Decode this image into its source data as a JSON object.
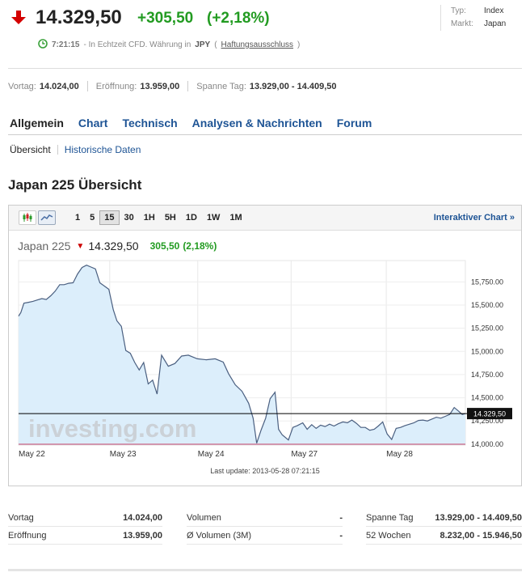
{
  "quote": {
    "price": "14.329,50",
    "change": "+305,50",
    "change_pct": "(+2,18%)",
    "direction_color": "#d40000",
    "positive_color": "#229b21",
    "time": "7:21:15",
    "realtime_text": "- In Echtzeit CFD. Währung in",
    "currency": "JPY",
    "disclaimer_open": "(",
    "disclaimer_link": "Haftungsausschluss",
    "disclaimer_close": ")"
  },
  "meta": [
    {
      "key": "Typ:",
      "value": "Index"
    },
    {
      "key": "Markt:",
      "value": "Japan"
    }
  ],
  "summary": [
    {
      "label": "Vortag:",
      "value": "14.024,00"
    },
    {
      "label": "Eröffnung:",
      "value": "13.959,00"
    },
    {
      "label": "Spanne Tag:",
      "value": "13.929,00 - 14.409,50"
    }
  ],
  "tabs": [
    {
      "label": "Allgemein",
      "active": true
    },
    {
      "label": "Chart",
      "active": false
    },
    {
      "label": "Technisch",
      "active": false
    },
    {
      "label": "Analysen & Nachrichten",
      "active": false
    },
    {
      "label": "Forum",
      "active": false
    }
  ],
  "subtabs": [
    {
      "label": "Übersicht",
      "active": true
    },
    {
      "label": "Historische Daten",
      "active": false
    }
  ],
  "page_title": "Japan 225 Übersicht",
  "chart_widget": {
    "ranges": [
      "1",
      "5",
      "15",
      "30",
      "1H",
      "5H",
      "1D",
      "1W",
      "1M"
    ],
    "selected_range": "15",
    "interactive_label": "Interaktiver Chart »",
    "name": "Japan 225",
    "price": "14.329,50",
    "change": "305,50",
    "change_pct": "(2,18%)",
    "last_update": "Last update: 2013-05-28 07:21:15",
    "watermark": "investing.com",
    "price_badge": "14.329,50"
  },
  "chart_data": {
    "type": "area",
    "title": "",
    "xlabel": "",
    "ylabel": "",
    "ylim": [
      13990,
      15980
    ],
    "x_ticks": [
      "May 22",
      "May 23",
      "May 24",
      "May 27",
      "May 28"
    ],
    "y_ticks": [
      14000,
      14250,
      14500,
      14750,
      15000,
      15250,
      15500,
      15750
    ],
    "y_tick_labels": [
      "14,000.00",
      "14,250.00",
      "14,500.00",
      "14,750.00",
      "15,000.00",
      "15,250.00",
      "15,500.00",
      "15,750.00"
    ],
    "reference_line": 14329.5,
    "line_color": "#4a5f80",
    "fill_color": "#dceefb",
    "series": [
      {
        "points": [
          [
            0,
            15380
          ],
          [
            0.5,
            15420
          ],
          [
            1.2,
            15520
          ],
          [
            2.2,
            15530
          ],
          [
            3.2,
            15540
          ],
          [
            4.2,
            15555
          ],
          [
            5.2,
            15570
          ],
          [
            6.2,
            15560
          ],
          [
            7.2,
            15600
          ],
          [
            8.2,
            15650
          ],
          [
            9.2,
            15720
          ],
          [
            10.2,
            15720
          ],
          [
            11.2,
            15735
          ],
          [
            12.2,
            15740
          ],
          [
            13.2,
            15835
          ],
          [
            14.2,
            15905
          ],
          [
            15.2,
            15930
          ],
          [
            16.2,
            15910
          ],
          [
            17.2,
            15890
          ],
          [
            18.2,
            15740
          ],
          [
            19.2,
            15705
          ],
          [
            20.2,
            15670
          ],
          [
            21.2,
            15450
          ],
          [
            22,
            15330
          ],
          [
            23,
            15270
          ],
          [
            24,
            15010
          ],
          [
            25,
            14980
          ],
          [
            26,
            14880
          ],
          [
            27,
            14800
          ],
          [
            28,
            14880
          ],
          [
            29,
            14650
          ],
          [
            30,
            14690
          ],
          [
            31,
            14540
          ],
          [
            32,
            14960
          ],
          [
            33.5,
            14840
          ],
          [
            35,
            14870
          ],
          [
            36.5,
            14950
          ],
          [
            38,
            14960
          ],
          [
            40,
            14920
          ],
          [
            42,
            14910
          ],
          [
            44,
            14920
          ],
          [
            45.8,
            14885
          ],
          [
            47,
            14760
          ],
          [
            48.5,
            14640
          ],
          [
            50,
            14570
          ],
          [
            51.5,
            14440
          ],
          [
            52.5,
            14280
          ],
          [
            53.3,
            14010
          ],
          [
            54.3,
            14155
          ],
          [
            55.3,
            14280
          ],
          [
            56.3,
            14490
          ],
          [
            57.4,
            14560
          ],
          [
            58.2,
            14160
          ],
          [
            59,
            14100
          ],
          [
            60.4,
            14045
          ],
          [
            61.4,
            14180
          ],
          [
            62.4,
            14200
          ],
          [
            63.6,
            14230
          ],
          [
            64.6,
            14160
          ],
          [
            65.6,
            14210
          ],
          [
            66.6,
            14170
          ],
          [
            67.6,
            14205
          ],
          [
            68.6,
            14190
          ],
          [
            69.6,
            14215
          ],
          [
            70.6,
            14195
          ],
          [
            71.6,
            14220
          ],
          [
            72.6,
            14240
          ],
          [
            73.6,
            14230
          ],
          [
            74.6,
            14260
          ],
          [
            75.6,
            14225
          ],
          [
            76.6,
            14180
          ],
          [
            77.6,
            14180
          ],
          [
            78.6,
            14150
          ],
          [
            79.6,
            14160
          ],
          [
            80.5,
            14195
          ],
          [
            81.5,
            14240
          ],
          [
            82.5,
            14110
          ],
          [
            83.5,
            14050
          ],
          [
            84.5,
            14170
          ],
          [
            85.5,
            14180
          ],
          [
            86.5,
            14200
          ],
          [
            87.5,
            14215
          ],
          [
            88.5,
            14230
          ],
          [
            89.5,
            14255
          ],
          [
            90.5,
            14260
          ],
          [
            91.5,
            14250
          ],
          [
            92.5,
            14270
          ],
          [
            93.5,
            14290
          ],
          [
            94.5,
            14280
          ],
          [
            95.5,
            14300
          ],
          [
            96.5,
            14320
          ],
          [
            97.5,
            14395
          ],
          [
            98.5,
            14355
          ],
          [
            99.3,
            14320
          ],
          [
            100,
            14329.5
          ]
        ]
      }
    ]
  },
  "stats": [
    {
      "key": "Vortag",
      "value": "14.024,00"
    },
    {
      "key": "Eröffnung",
      "value": "13.959,00"
    },
    {
      "key": "Volumen",
      "value": "-"
    },
    {
      "key": "Ø Volumen (3M)",
      "value": "-"
    },
    {
      "key": "Spanne Tag",
      "value": "13.929,00 - 14.409,50"
    },
    {
      "key": "52 Wochen",
      "value": "8.232,00 - 15.946,50"
    }
  ]
}
